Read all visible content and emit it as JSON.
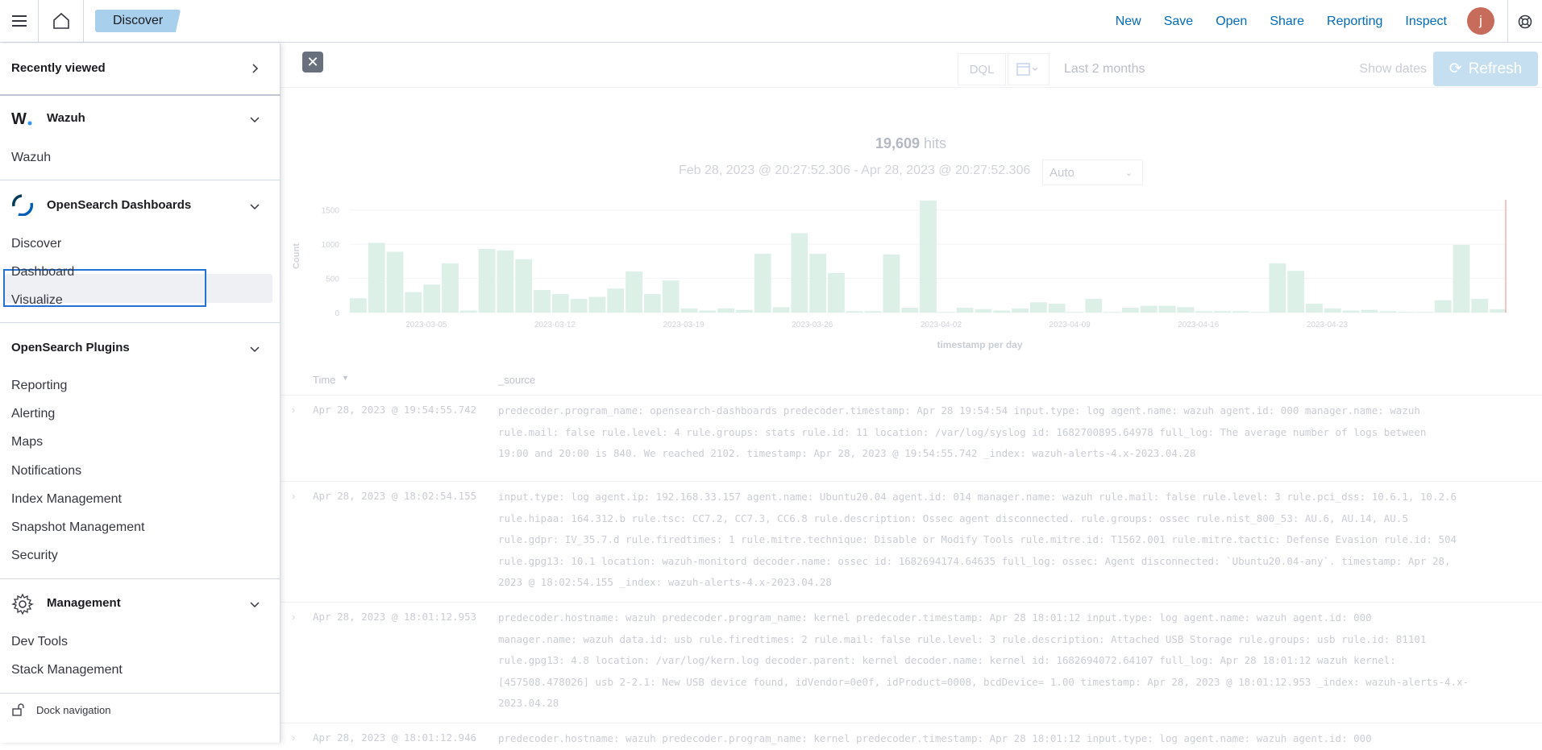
{
  "topbar": {
    "breadcrumb": "Discover",
    "nav": [
      "New",
      "Save",
      "Open",
      "Share",
      "Reporting",
      "Inspect"
    ],
    "avatar_initial": "j"
  },
  "query": {
    "language": "DQL",
    "date_range": "Last 2 months",
    "show_dates": "Show dates",
    "refresh": "Refresh"
  },
  "histogram": {
    "hits_count": "19,609",
    "hits_label": "hits",
    "range": "Feb 28, 2023 @ 20:27:52.306 - Apr 28, 2023 @ 20:27:52.306",
    "interval": "Auto"
  },
  "chart_data": {
    "type": "bar",
    "ylabel": "Count",
    "xlabel": "timestamp per day",
    "y_ticks": [
      "1500",
      "1000",
      "500",
      "0"
    ],
    "ylim": [
      0,
      1650
    ],
    "x_tick_labels": [
      "2023-03-05",
      "2023-03-12",
      "2023-03-19",
      "2023-03-26",
      "2023-04-02",
      "2023-04-09",
      "2023-04-16",
      "2023-04-23"
    ],
    "values": [
      210,
      1020,
      890,
      300,
      410,
      720,
      30,
      930,
      910,
      780,
      330,
      270,
      200,
      230,
      350,
      600,
      270,
      470,
      60,
      30,
      60,
      40,
      860,
      80,
      1160,
      860,
      580,
      20,
      20,
      850,
      70,
      1640,
      10,
      70,
      50,
      30,
      60,
      150,
      130,
      10,
      200,
      10,
      70,
      100,
      100,
      80,
      20,
      20,
      20,
      10,
      720,
      610,
      130,
      60,
      30,
      40,
      20,
      10,
      10,
      180,
      990,
      200,
      50
    ]
  },
  "table": {
    "col_time": "Time",
    "col_source": "_source",
    "rows": [
      {
        "time": "Apr 28, 2023 @ 19:54:55.742",
        "lines": [
          "predecoder.program_name: opensearch-dashboards predecoder.timestamp: Apr 28 19:54:54 input.type: log agent.name: wazuh agent.id: 000 manager.name: wazuh",
          "rule.mail: false rule.level: 4 rule.groups: stats rule.id: 11 location: /var/log/syslog id: 1682700895.64978 full_log: The average number of logs between",
          "19:00 and 20:00 is 840. We reached 2102. timestamp: Apr 28, 2023 @ 19:54:55.742 _index: wazuh-alerts-4.x-2023.04.28"
        ]
      },
      {
        "time": "Apr 28, 2023 @ 18:02:54.155",
        "lines": [
          "input.type: log agent.ip: 192.168.33.157 agent.name: Ubuntu20.04 agent.id: 014 manager.name: wazuh rule.mail: false rule.level: 3 rule.pci_dss: 10.6.1, 10.2.6",
          "rule.hipaa: 164.312.b rule.tsc: CC7.2, CC7.3, CC6.8 rule.description: Ossec agent disconnected. rule.groups: ossec rule.nist_800_53: AU.6, AU.14, AU.5",
          "rule.gdpr: IV_35.7.d rule.firedtimes: 1 rule.mitre.technique: Disable or Modify Tools rule.mitre.id: T1562.001 rule.mitre.tactic: Defense Evasion rule.id: 504",
          "rule.gpg13: 10.1 location: wazuh-monitord decoder.name: ossec id: 1682694174.64635 full_log: ossec: Agent disconnected: `Ubuntu20.04-any`. timestamp: Apr 28,",
          "2023 @ 18:02:54.155 _index: wazuh-alerts-4.x-2023.04.28"
        ]
      },
      {
        "time": "Apr 28, 2023 @ 18:01:12.953",
        "lines": [
          "predecoder.hostname: wazuh predecoder.program_name: kernel predecoder.timestamp: Apr 28 18:01:12 input.type: log agent.name: wazuh agent.id: 000",
          "manager.name: wazuh data.id: usb rule.firedtimes: 2 rule.mail: false rule.level: 3 rule.description: Attached USB Storage rule.groups: usb rule.id: 81101",
          "rule.gpg13: 4.8 location: /var/log/kern.log decoder.parent: kernel decoder.name: kernel id: 1682694072.64107 full_log: Apr 28 18:01:12 wazuh kernel:",
          "[457508.478026] usb 2-2.1: New USB device found, idVendor=0e0f, idProduct=0008, bcdDevice= 1.00 timestamp: Apr 28, 2023 @ 18:01:12.953 _index: wazuh-alerts-4.x-",
          "2023.04.28"
        ]
      },
      {
        "time": "Apr 28, 2023 @ 18:01:12.946",
        "lines": [
          "predecoder.hostname: wazuh predecoder.program_name: kernel predecoder.timestamp: Apr 28 18:01:12 input.type: log agent.name: wazuh agent.id: 000"
        ]
      }
    ]
  },
  "sidebar": {
    "recently_viewed": "Recently viewed",
    "wazuh_group": "Wazuh",
    "wazuh_items": [
      "Wazuh"
    ],
    "osd_group": "OpenSearch Dashboards",
    "osd_items": [
      "Discover",
      "Dashboard",
      "Visualize"
    ],
    "plugins_group": "OpenSearch Plugins",
    "plugins_items": [
      "Reporting",
      "Alerting",
      "Maps",
      "Notifications",
      "Index Management",
      "Snapshot Management",
      "Security"
    ],
    "management_group": "Management",
    "management_items": [
      "Dev Tools",
      "Stack Management"
    ],
    "dock": "Dock navigation"
  }
}
